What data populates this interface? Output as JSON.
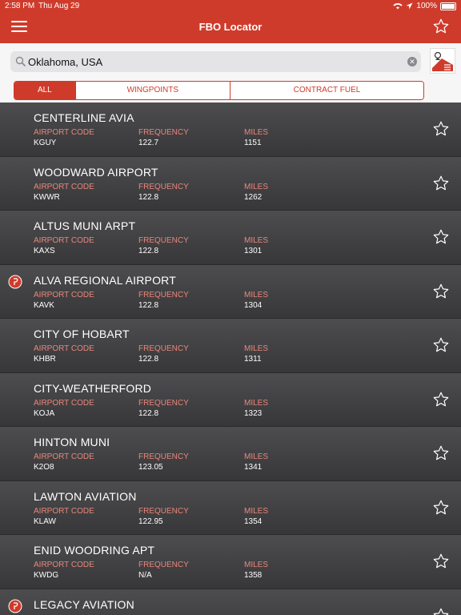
{
  "status": {
    "time": "2:58 PM",
    "date": "Thu Aug 29",
    "battery": "100%"
  },
  "nav": {
    "title": "FBO Locator"
  },
  "search": {
    "value": "Oklahoma, USA"
  },
  "segments": [
    {
      "label": "ALL",
      "active": true
    },
    {
      "label": "WINGPOINTS",
      "active": false
    },
    {
      "label": "CONTRACT FUEL",
      "active": false
    }
  ],
  "headers": {
    "code": "AIRPORT CODE",
    "freq": "FREQUENCY",
    "miles": "MILES"
  },
  "rows": [
    {
      "name": "CENTERLINE AVIA",
      "code": "KGUY",
      "freq": "122.7",
      "miles": "1151",
      "wingpoint": false
    },
    {
      "name": "WOODWARD AIRPORT",
      "code": "KWWR",
      "freq": "122.8",
      "miles": "1262",
      "wingpoint": false
    },
    {
      "name": "ALTUS MUNI ARPT",
      "code": "KAXS",
      "freq": "122.8",
      "miles": "1301",
      "wingpoint": false
    },
    {
      "name": "ALVA REGIONAL AIRPORT",
      "code": "KAVK",
      "freq": "122.8",
      "miles": "1304",
      "wingpoint": true
    },
    {
      "name": "CITY OF HOBART",
      "code": "KHBR",
      "freq": "122.8",
      "miles": "1311",
      "wingpoint": false
    },
    {
      "name": "CITY-WEATHERFORD",
      "code": "KOJA",
      "freq": "122.8",
      "miles": "1323",
      "wingpoint": false
    },
    {
      "name": "HINTON MUNI",
      "code": "K2O8",
      "freq": "123.05",
      "miles": "1341",
      "wingpoint": false
    },
    {
      "name": "LAWTON AVIATION",
      "code": "KLAW",
      "freq": "122.95",
      "miles": "1354",
      "wingpoint": false
    },
    {
      "name": "ENID WOODRING APT",
      "code": "KWDG",
      "freq": "N/A",
      "miles": "1358",
      "wingpoint": false
    },
    {
      "name": "LEGACY AVIATION",
      "code": "",
      "freq": "",
      "miles": "",
      "wingpoint": true
    }
  ],
  "icons": {
    "menu": "menu-icon",
    "favorite": "star-outline-icon",
    "search": "search-icon",
    "clear": "clear-icon",
    "map": "map-list-icon",
    "wingpoint": "wingpoint-badge-icon"
  },
  "colors": {
    "brand": "#cf3b2b",
    "label": "#e8867a",
    "row": "#444447"
  }
}
